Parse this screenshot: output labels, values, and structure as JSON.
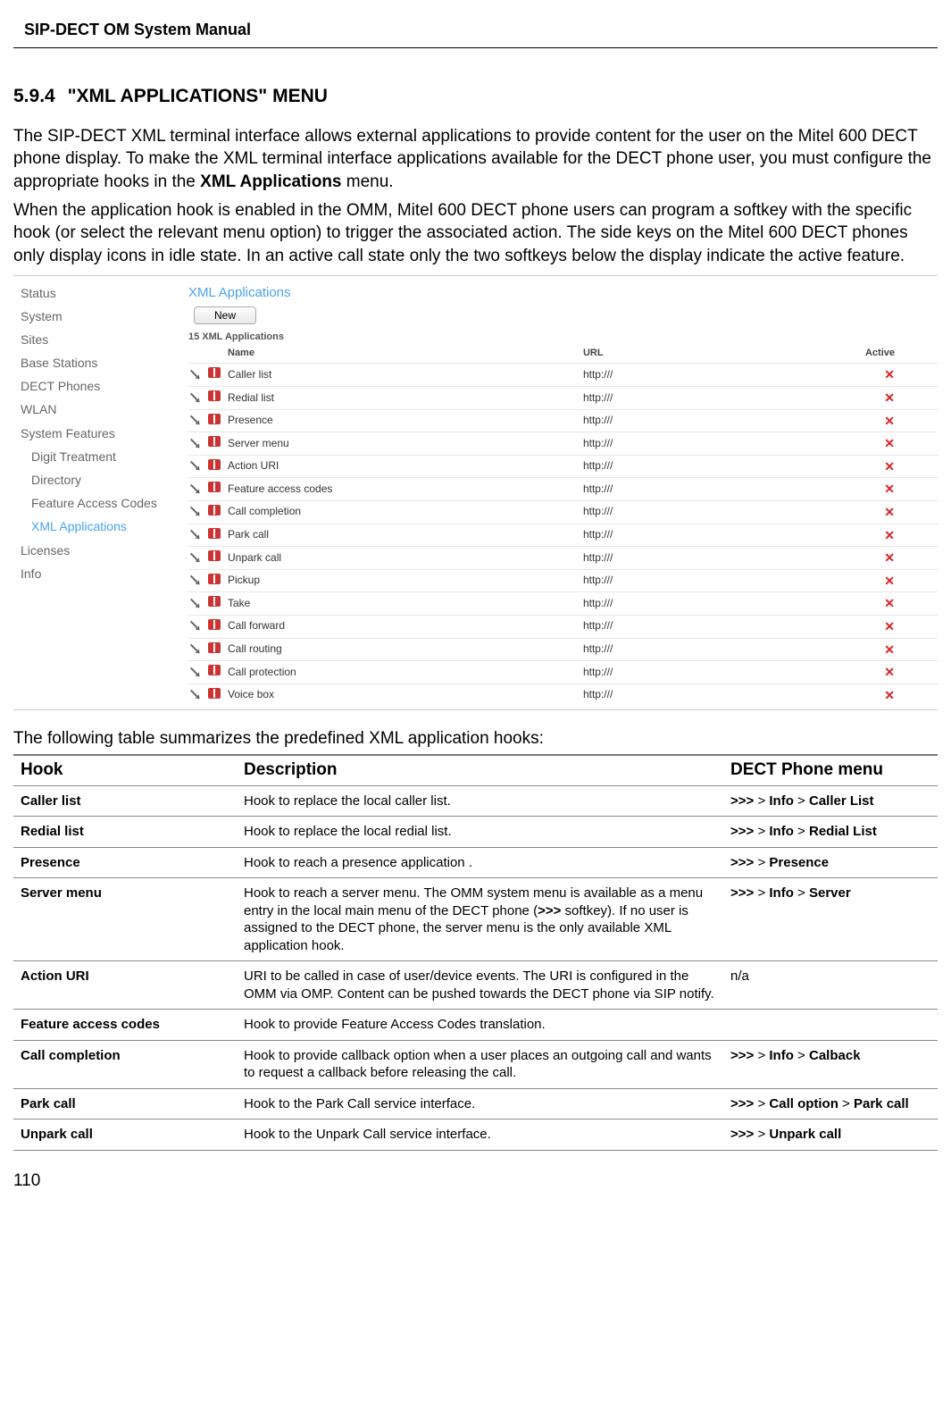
{
  "manual_title": "SIP-DECT OM System Manual",
  "section": {
    "number": "5.9.4",
    "title": "\"XML APPLICATIONS\" MENU"
  },
  "para1_pre": "The SIP-DECT XML terminal interface allows external applications to provide content for the user on the Mitel 600 DECT phone display. To make the XML terminal interface applications available for the DECT phone user, you must configure the appropriate hooks in the ",
  "para1_bold": "XML Applications",
  "para1_post": " menu.",
  "para2": "When the application hook is enabled in the OMM, Mitel 600 DECT phone users can program a softkey with the specific hook (or select the relevant menu option) to trigger the associated action. The side keys on the Mitel 600 DECT phones only display icons in idle state. In an active call state only the two softkeys below the display indicate the active feature.",
  "ui": {
    "sidebar": [
      "Status",
      "System",
      "Sites",
      "Base Stations",
      "DECT Phones",
      "WLAN",
      "System Features"
    ],
    "sidebar_sub": [
      "Digit Treatment",
      "Directory",
      "Feature Access Codes",
      "XML Applications"
    ],
    "sidebar_bottom": [
      "Licenses",
      "Info"
    ],
    "panel_title": "XML Applications",
    "button_new": "New",
    "list_header": "15 XML Applications",
    "cols": {
      "name": "Name",
      "url": "URL",
      "active": "Active"
    },
    "rows": [
      {
        "name": "Caller list",
        "url": "http:///"
      },
      {
        "name": "Redial list",
        "url": "http:///"
      },
      {
        "name": "Presence",
        "url": "http:///"
      },
      {
        "name": "Server menu",
        "url": "http:///"
      },
      {
        "name": "Action URI",
        "url": "http:///"
      },
      {
        "name": "Feature access codes",
        "url": "http:///"
      },
      {
        "name": "Call completion",
        "url": "http:///"
      },
      {
        "name": "Park call",
        "url": "http:///"
      },
      {
        "name": "Unpark call",
        "url": "http:///"
      },
      {
        "name": "Pickup",
        "url": "http:///"
      },
      {
        "name": "Take",
        "url": "http:///"
      },
      {
        "name": "Call forward",
        "url": "http:///"
      },
      {
        "name": "Call routing",
        "url": "http:///"
      },
      {
        "name": "Call protection",
        "url": "http:///"
      },
      {
        "name": "Voice box",
        "url": "http:///"
      }
    ]
  },
  "table_caption": "The following table summarizes the predefined XML application hooks:",
  "hooks_header": {
    "hook": "Hook",
    "desc": "Description",
    "menu": "DECT Phone menu"
  },
  "hooks": [
    {
      "hook": "Caller list",
      "desc": "Hook to replace the local caller list.",
      "menu_prefix": ">>>",
      "menu_rest": " > Info > Caller List",
      "menu_bold_parts": [
        "Info",
        "Caller List"
      ]
    },
    {
      "hook": "Redial list",
      "desc": "Hook to replace the local redial list.",
      "menu_prefix": ">>>",
      "menu_rest": " > Info > Redial List",
      "menu_bold_parts": [
        "Info",
        "Redial List"
      ]
    },
    {
      "hook": "Presence",
      "desc": "Hook to reach a presence application .",
      "menu_prefix": ">>>",
      "menu_rest": " > Presence",
      "menu_bold_parts": [
        "Presence"
      ]
    },
    {
      "hook": "Server menu",
      "desc": "Hook to reach a server menu. The OMM system menu is available as a menu entry in the local main menu of the DECT phone (>>> softkey). If no user is assigned to the DECT phone, the server menu is the only available XML application hook.",
      "menu_prefix": ">>>",
      "menu_rest": " > Info > Server",
      "menu_bold_parts": [
        "Info",
        "Server"
      ]
    },
    {
      "hook": "Action URI",
      "desc": "URI to be called in case of user/device events. The URI is configured in the OMM via OMP. Content can be pushed towards the DECT phone via SIP notify.",
      "menu_plain": "n/a"
    },
    {
      "hook": "Feature access codes",
      "desc": "Hook to provide Feature Access Codes translation.",
      "menu_plain": ""
    },
    {
      "hook": "Call completion",
      "desc": "Hook to provide callback option when a user places an outgoing call and wants to request a callback before releasing the call.",
      "menu_prefix": ">>>",
      "menu_rest": " > Info > Calback",
      "menu_bold_parts": [
        "Info",
        "Calback"
      ]
    },
    {
      "hook": "Park call",
      "desc": "Hook to the Park Call service interface.",
      "menu_prefix": ">>>",
      "menu_rest": " > Call option > Park call",
      "menu_bold_parts": [
        "Call option",
        "Park call"
      ]
    },
    {
      "hook": "Unpark call",
      "desc": "Hook to the Unpark Call service interface.",
      "menu_prefix": ">>>",
      "menu_rest": " > Unpark call",
      "menu_bold_parts": [
        "Unpark call"
      ]
    }
  ],
  "page_number": "110"
}
